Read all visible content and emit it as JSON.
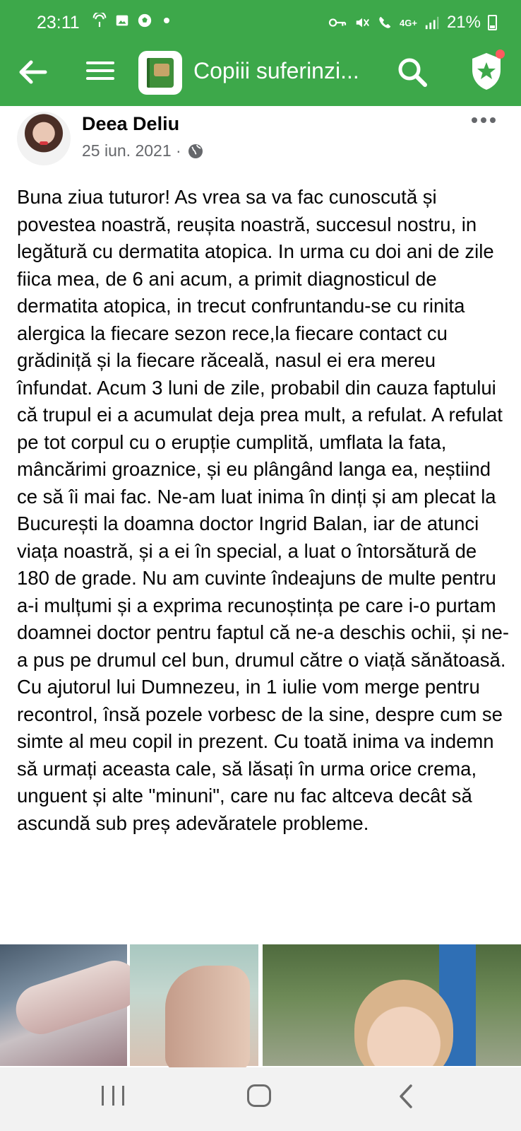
{
  "status_bar": {
    "time": "23:11",
    "battery": "21%",
    "network": "4G+"
  },
  "toolbar": {
    "title": "Copiii suferinzi..."
  },
  "post": {
    "author": "Deea Deliu",
    "date": "25 iun. 2021 ·",
    "text": "Buna ziua tuturor! As vrea sa va fac cunoscută și povestea noastră, reușita noastră, succesul nostru, in legătură cu dermatita atopica. In urma cu doi ani de zile fiica mea, de 6 ani acum, a primit diagnosticul de dermatita atopica, in trecut confruntandu-se cu rinita alergica la fiecare sezon rece,la fiecare contact cu grădiniță și la fiecare răceală, nasul ei era mereu înfundat. Acum 3 luni de zile, probabil din cauza faptului că trupul ei a acumulat deja prea mult, a refulat. A refulat pe tot corpul cu o erupție cumplită, umflata la fata, mâncărimi groaznice, și eu plângând langa ea, neștiind ce să îi mai fac. Ne-am luat inima în dinți și am plecat la București la doamna doctor Ingrid Balan, iar de atunci viața noastră, și a ei în special, a luat o întorsătură de 180 de grade. Nu am cuvinte îndeajuns de multe pentru a-i mulțumi și a exprima recunoștința pe care i-o purtam doamnei doctor pentru faptul că ne-a deschis ochii, și ne-a pus pe drumul cel bun, drumul către o viață sănătoasă. Cu ajutorul lui Dumnezeu, in 1 iulie vom merge pentru recontrol, însă pozele vorbesc de la sine, despre cum se simte al meu copil in prezent. Cu toată inima va indemn să urmați aceasta cale, să lăsați în urma orice crema, unguent și alte \"minuni\", care nu fac altceva decât să ascundă sub preș adevăratele probleme."
  },
  "colors": {
    "app_bar": "#3da84a",
    "text_primary": "#050505",
    "text_secondary": "#65676b",
    "badge": "#ff5a5f"
  },
  "icons": {
    "back": "back-arrow-icon",
    "menu": "menu-icon",
    "search": "search-icon",
    "shield": "shield-star-icon",
    "more": "more-options-icon",
    "privacy": "globe-icon"
  }
}
